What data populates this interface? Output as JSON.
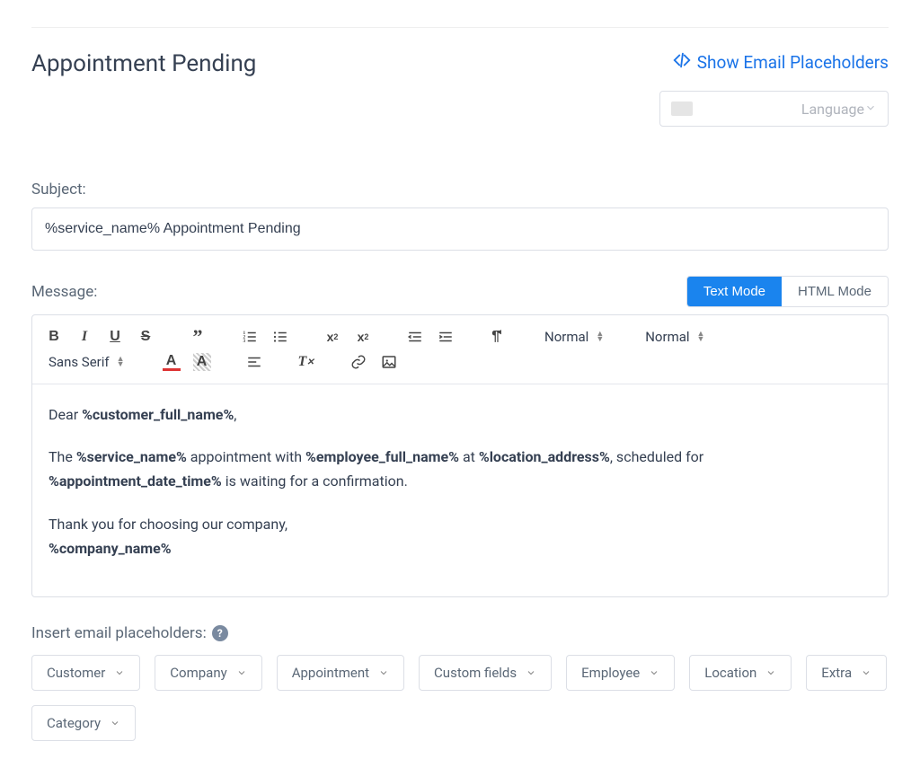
{
  "header": {
    "title": "Appointment Pending",
    "show_placeholders": "Show Email Placeholders",
    "language_label": "Language"
  },
  "subject": {
    "label": "Subject:",
    "value": "%service_name% Appointment Pending"
  },
  "message": {
    "label": "Message:",
    "text_mode": "Text Mode",
    "html_mode": "HTML Mode"
  },
  "toolbar": {
    "heading": "Normal",
    "size": "Normal",
    "font": "Sans Serif"
  },
  "body": {
    "line1_pre": "Dear ",
    "line1_b": "%customer_full_name%",
    "line1_post": ",",
    "line2_t1": "The ",
    "line2_b1": "%service_name%",
    "line2_t2": " appointment with ",
    "line2_b2": "%employee_full_name%",
    "line2_t3": " at ",
    "line2_b3": "%location_address%",
    "line2_t4": ", scheduled for ",
    "line2_b4": "%appointment_date_time%",
    "line2_t5": " is waiting for a confirmation.",
    "line3": "Thank you for choosing our company,",
    "line3_b": "%company_name%"
  },
  "placeholders": {
    "label": "Insert email placeholders:",
    "chips": [
      "Customer",
      "Company",
      "Appointment",
      "Custom fields",
      "Employee",
      "Location",
      "Extra",
      "Category"
    ]
  }
}
